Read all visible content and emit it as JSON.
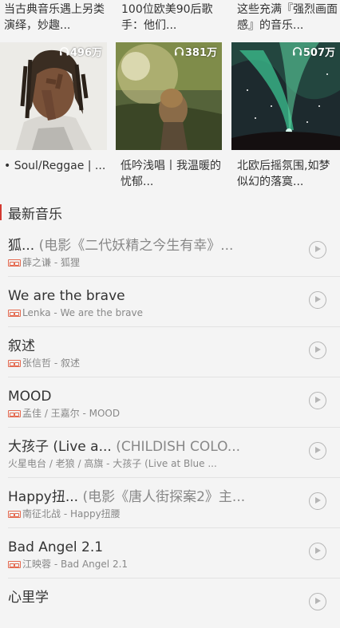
{
  "playlists": [
    {
      "top_text": "当古典音乐遇上另类演绎，妙趣...",
      "play_count": "496万",
      "bottom_text": "• Soul/Reggae | ..."
    },
    {
      "top_text": "100位欧美90后歌手：他们...",
      "play_count": "381万",
      "bottom_text": "低吟浅唱丨我温暖的忧郁..."
    },
    {
      "top_text": "这些充满『强烈画面感』的音乐...",
      "play_count": "507万",
      "bottom_text": "北欧后摇氛围,如梦似幻的落寞..."
    }
  ],
  "section": {
    "title": "最新音乐"
  },
  "songs": [
    {
      "title": "狐...",
      "alias": " (电影《二代妖精之今生有幸》...",
      "meta": "薛之谦 - 狐狸",
      "sq": true
    },
    {
      "title": "We are the brave",
      "alias": "",
      "meta": "Lenka - We are the brave",
      "sq": true
    },
    {
      "title": "叙述",
      "alias": "",
      "meta": "张信哲 - 叙述",
      "sq": true
    },
    {
      "title": "MOOD",
      "alias": "",
      "meta": "孟佳 / 王嘉尔 - MOOD",
      "sq": true
    },
    {
      "title": "大孩子 (Live a...",
      "alias": " (CHILDISH COLO...",
      "meta": "火星电台 / 老狼 / 高旗 - 大孩子 (Live at Blue ...",
      "sq": false
    },
    {
      "title": "Happy扭...",
      "alias": " (电影《唐人街探案2》主...",
      "meta": "南征北战 - Happy扭腰",
      "sq": true
    },
    {
      "title": "Bad Angel 2.1",
      "alias": "",
      "meta": "江映蓉 - Bad Angel 2.1",
      "sq": true
    },
    {
      "title": "心里学",
      "alias": "",
      "meta": "",
      "sq": false
    }
  ],
  "colors": {
    "accent_red": "#d33a31",
    "sq_badge": "#e4694f",
    "background": "#f4f4f4"
  }
}
